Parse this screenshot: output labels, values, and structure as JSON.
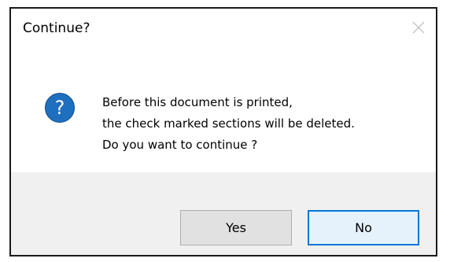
{
  "dialog": {
    "title": "Continue?",
    "icon": "question-icon",
    "close_icon": "close-icon",
    "message_lines": [
      "Before this document is printed,",
      "the check marked sections will be deleted.",
      "Do you want to continue ?"
    ],
    "buttons": {
      "yes_label": "Yes",
      "no_label": "No"
    },
    "colors": {
      "icon_fill": "#1f6fbf",
      "default_button_border": "#0078d7",
      "footer_background": "#f0f0f0"
    }
  }
}
